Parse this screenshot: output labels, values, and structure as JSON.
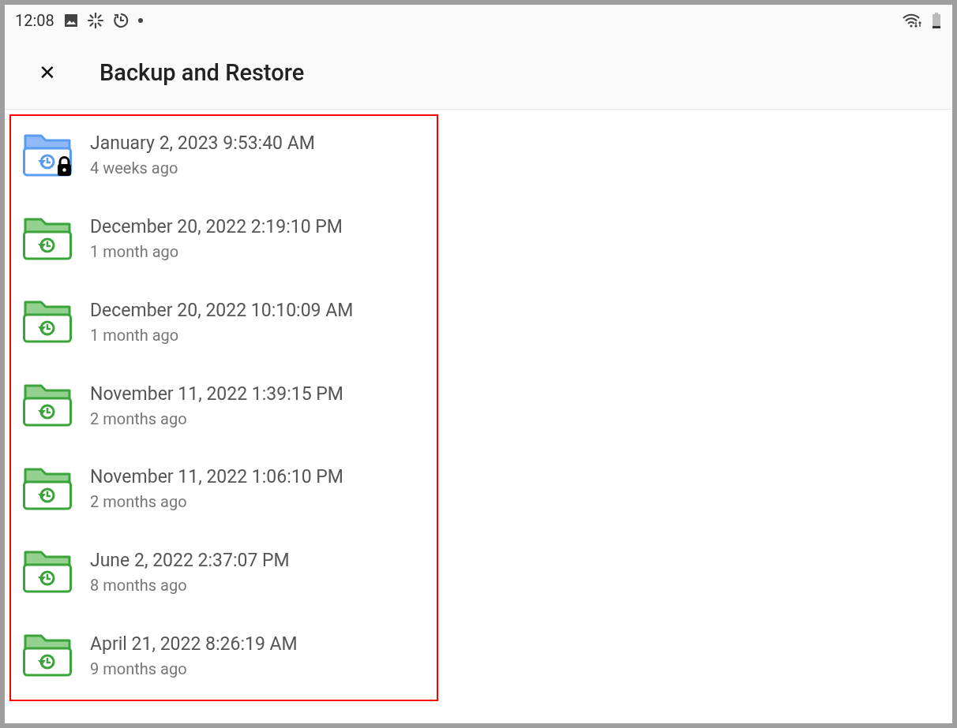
{
  "status_bar": {
    "time": "12:08"
  },
  "app_bar": {
    "close_label": "✕",
    "title": "Backup and Restore"
  },
  "highlight": {
    "color": "#ff0000"
  },
  "backups": [
    {
      "date": "January 2, 2023 9:53:40 AM",
      "age": "4 weeks ago",
      "locked": true
    },
    {
      "date": "December 20, 2022 2:19:10 PM",
      "age": "1 month ago",
      "locked": false
    },
    {
      "date": "December 20, 2022 10:10:09 AM",
      "age": "1 month ago",
      "locked": false
    },
    {
      "date": "November 11, 2022 1:39:15 PM",
      "age": "2 months ago",
      "locked": false
    },
    {
      "date": "November 11, 2022 1:06:10 PM",
      "age": "2 months ago",
      "locked": false
    },
    {
      "date": "June 2, 2022 2:37:07 PM",
      "age": "8 months ago",
      "locked": false
    },
    {
      "date": "April 21, 2022 8:26:19 AM",
      "age": "9 months ago",
      "locked": false
    }
  ]
}
